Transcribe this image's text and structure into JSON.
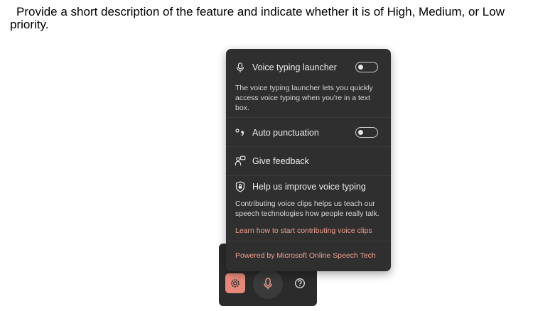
{
  "instruction": "Provide a short description of the feature and indicate whether it is of High, Medium, or Low priority.",
  "panel": {
    "voice_typing_launcher": {
      "label": "Voice typing launcher",
      "toggle": "off",
      "icon": "microphone-icon",
      "description": "The voice typing launcher lets you quickly access voice typing when you're in a text box."
    },
    "auto_punctuation": {
      "label": "Auto punctuation",
      "toggle": "off",
      "icon": "punctuation-icon"
    },
    "give_feedback": {
      "label": "Give feedback",
      "icon": "feedback-icon"
    },
    "improve_voice": {
      "label": "Help us improve voice typing",
      "icon": "shield-icon",
      "description": "Contributing voice clips helps us teach our speech technologies how people really talk.",
      "link": "Learn how to start contributing voice clips"
    },
    "powered_by": "Powered by Microsoft Online Speech Tech"
  },
  "toolbar": {
    "buttons": [
      "settings-icon",
      "microphone-icon",
      "help-icon"
    ],
    "accent_color": "#e7897a"
  }
}
